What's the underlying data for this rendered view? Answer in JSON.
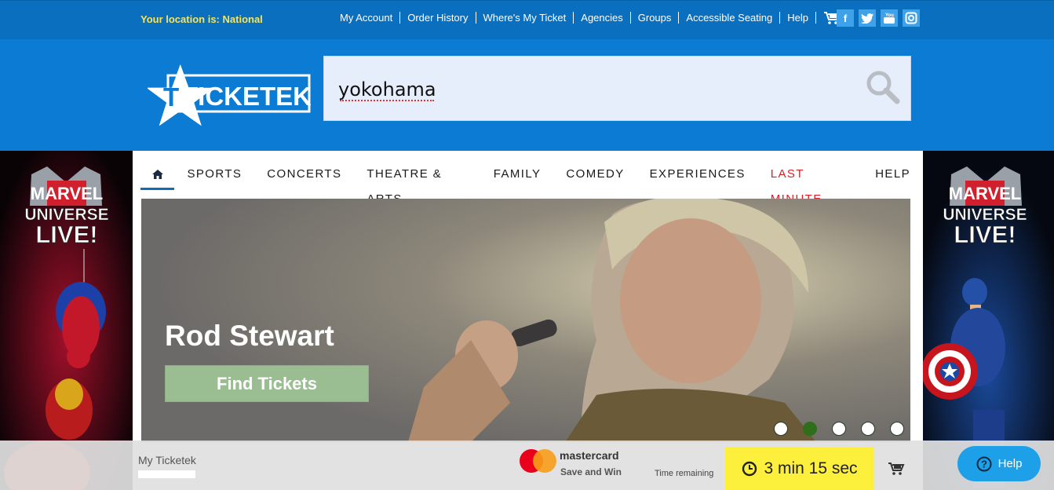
{
  "topbar": {
    "location_label": "Your location is:",
    "location_value": "National",
    "links": [
      "My Account",
      "Order History",
      "Where's My Ticket",
      "Agencies",
      "Groups",
      "Accessible Seating",
      "Help"
    ],
    "social": [
      "facebook-icon",
      "twitter-icon",
      "youtube-icon",
      "instagram-icon"
    ]
  },
  "header": {
    "logo_text": "TICKETEK",
    "search_value": "yokohama"
  },
  "nav": {
    "items": [
      "SPORTS",
      "CONCERTS",
      "THEATRE & ARTS",
      "FAMILY",
      "COMEDY",
      "EXPERIENCES",
      "LAST MINUTE",
      "HELP"
    ]
  },
  "hero": {
    "title": "Rod Stewart",
    "cta": "Find Tickets",
    "dots": 5,
    "active_dot": 2
  },
  "side_banner": {
    "line1": "MARVEL",
    "line2": "UNIVERSE",
    "line3": "LIVE!"
  },
  "bottombar": {
    "my_ticketek": "My Ticketek",
    "mastercard": "mastercard",
    "mastercard_sub": "Save and Win",
    "time_remaining_label": "Time remaining",
    "timer": "3 min 15 sec",
    "help": "Help"
  },
  "colors": {
    "topbar": "#0a6fbf",
    "header": "#0b7bd3",
    "accent_red": "#d2232a",
    "timer_bg": "#fdf03c",
    "help_bg": "#1ea0e8"
  }
}
